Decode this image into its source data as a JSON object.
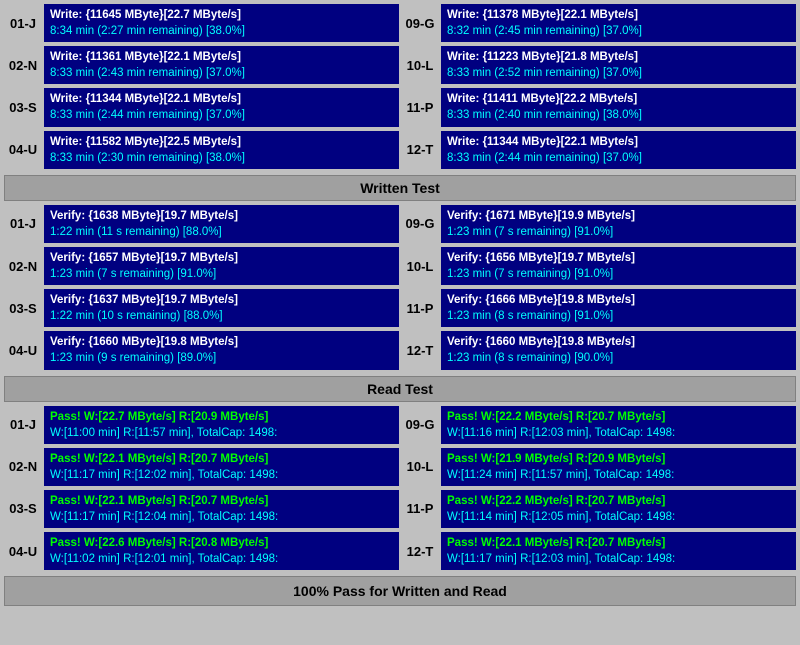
{
  "write_section": {
    "rows_left": [
      {
        "label": "01-J",
        "line1": "Write: {11645 MByte}[22.7 MByte/s]",
        "line2": "8:34 min (2:27 min remaining)  [38.0%]"
      },
      {
        "label": "02-N",
        "line1": "Write: {11361 MByte}[22.1 MByte/s]",
        "line2": "8:33 min (2:43 min remaining)  [37.0%]"
      },
      {
        "label": "03-S",
        "line1": "Write: {11344 MByte}[22.1 MByte/s]",
        "line2": "8:33 min (2:44 min remaining)  [37.0%]"
      },
      {
        "label": "04-U",
        "line1": "Write: {11582 MByte}[22.5 MByte/s]",
        "line2": "8:33 min (2:30 min remaining)  [38.0%]"
      }
    ],
    "rows_right": [
      {
        "label": "09-G",
        "line1": "Write: {11378 MByte}[22.1 MByte/s]",
        "line2": "8:32 min (2:45 min remaining)  [37.0%]"
      },
      {
        "label": "10-L",
        "line1": "Write: {11223 MByte}[21.8 MByte/s]",
        "line2": "8:33 min (2:52 min remaining)  [37.0%]"
      },
      {
        "label": "11-P",
        "line1": "Write: {11411 MByte}[22.2 MByte/s]",
        "line2": "8:33 min (2:40 min remaining)  [38.0%]"
      },
      {
        "label": "12-T",
        "line1": "Write: {11344 MByte}[22.1 MByte/s]",
        "line2": "8:33 min (2:44 min remaining)  [37.0%]"
      }
    ],
    "header": "Written Test"
  },
  "verify_section": {
    "rows_left": [
      {
        "label": "01-J",
        "line1": "Verify: {1638 MByte}[19.7 MByte/s]",
        "line2": "1:22 min (11 s remaining)   [88.0%]"
      },
      {
        "label": "02-N",
        "line1": "Verify: {1657 MByte}[19.7 MByte/s]",
        "line2": "1:23 min (7 s remaining)   [91.0%]"
      },
      {
        "label": "03-S",
        "line1": "Verify: {1637 MByte}[19.7 MByte/s]",
        "line2": "1:22 min (10 s remaining)   [88.0%]"
      },
      {
        "label": "04-U",
        "line1": "Verify: {1660 MByte}[19.8 MByte/s]",
        "line2": "1:23 min (9 s remaining)   [89.0%]"
      }
    ],
    "rows_right": [
      {
        "label": "09-G",
        "line1": "Verify: {1671 MByte}[19.9 MByte/s]",
        "line2": "1:23 min (7 s remaining)   [91.0%]"
      },
      {
        "label": "10-L",
        "line1": "Verify: {1656 MByte}[19.7 MByte/s]",
        "line2": "1:23 min (7 s remaining)   [91.0%]"
      },
      {
        "label": "11-P",
        "line1": "Verify: {1666 MByte}[19.8 MByte/s]",
        "line2": "1:23 min (8 s remaining)   [91.0%]"
      },
      {
        "label": "12-T",
        "line1": "Verify: {1660 MByte}[19.8 MByte/s]",
        "line2": "1:23 min (8 s remaining)   [90.0%]"
      }
    ],
    "header": "Read Test"
  },
  "read_section": {
    "rows_left": [
      {
        "label": "01-J",
        "line1": "Pass! W:[22.7 MByte/s] R:[20.9 MByte/s]",
        "line2": "W:[11:00 min] R:[11:57 min], TotalCap: 1498:"
      },
      {
        "label": "02-N",
        "line1": "Pass! W:[22.1 MByte/s] R:[20.7 MByte/s]",
        "line2": "W:[11:17 min] R:[12:02 min], TotalCap: 1498:"
      },
      {
        "label": "03-S",
        "line1": "Pass! W:[22.1 MByte/s] R:[20.7 MByte/s]",
        "line2": "W:[11:17 min] R:[12:04 min], TotalCap: 1498:"
      },
      {
        "label": "04-U",
        "line1": "Pass! W:[22.6 MByte/s] R:[20.8 MByte/s]",
        "line2": "W:[11:02 min] R:[12:01 min], TotalCap: 1498:"
      }
    ],
    "rows_right": [
      {
        "label": "09-G",
        "line1": "Pass! W:[22.2 MByte/s] R:[20.7 MByte/s]",
        "line2": "W:[11:16 min] R:[12:03 min], TotalCap: 1498:"
      },
      {
        "label": "10-L",
        "line1": "Pass! W:[21.9 MByte/s] R:[20.9 MByte/s]",
        "line2": "W:[11:24 min] R:[11:57 min], TotalCap: 1498:"
      },
      {
        "label": "11-P",
        "line1": "Pass! W:[22.2 MByte/s] R:[20.7 MByte/s]",
        "line2": "W:[11:14 min] R:[12:05 min], TotalCap: 1498:"
      },
      {
        "label": "12-T",
        "line1": "Pass! W:[22.1 MByte/s] R:[20.7 MByte/s]",
        "line2": "W:[11:17 min] R:[12:03 min], TotalCap: 1498:"
      }
    ]
  },
  "final_banner": "100% Pass for Written and Read"
}
